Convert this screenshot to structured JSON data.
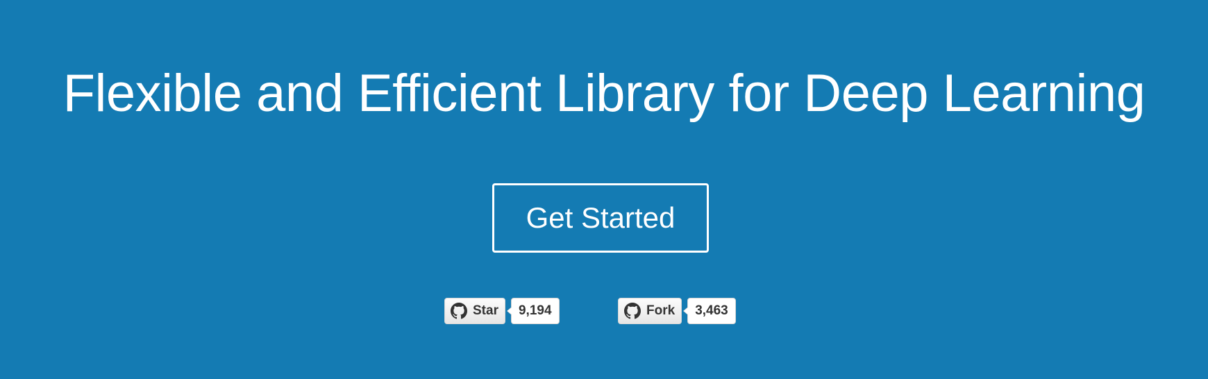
{
  "hero": {
    "headline": "Flexible and Efficient Library for Deep Learning",
    "cta_label": "Get Started",
    "background_color": "#147bb3"
  },
  "github": {
    "star": {
      "label": "Star",
      "count": "9,194",
      "icon": "github-octocat-icon"
    },
    "fork": {
      "label": "Fork",
      "count": "3,463",
      "icon": "github-octocat-icon"
    }
  }
}
